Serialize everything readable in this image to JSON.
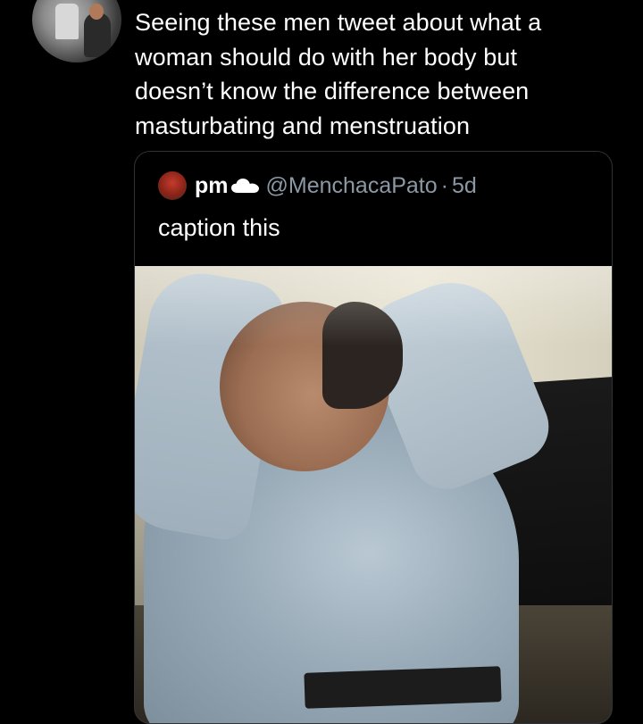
{
  "tweet": {
    "text_lines": [
      "Seeing these men tweet about what a",
      "woman should do with her body but",
      "doesn’t know the difference between",
      "masturbating and menstruation"
    ],
    "avatar_icon": "profile-photo"
  },
  "quoted_tweet": {
    "display_name": "pm",
    "name_emoji_icon": "cloud-icon",
    "handle": "@MenchacaPato",
    "separator": "·",
    "timestamp": "5d",
    "text": "caption this",
    "media_icon": "photo-media"
  },
  "colors": {
    "background": "#000000",
    "primary_text": "#ffffff",
    "secondary_text": "#8b98a5",
    "border": "#2f3336"
  }
}
